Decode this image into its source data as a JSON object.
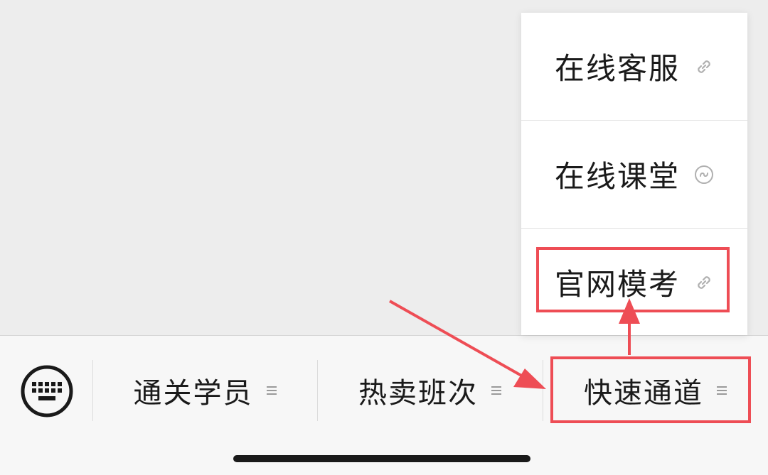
{
  "chat": {},
  "menu_bar": {
    "items": [
      {
        "label": "通关学员",
        "icon": "menu-lines-icon"
      },
      {
        "label": "热卖班次",
        "icon": "menu-lines-icon"
      },
      {
        "label": "快速通道",
        "icon": "menu-lines-icon"
      }
    ],
    "keyboard_icon": "keyboard-icon"
  },
  "submenu": {
    "items": [
      {
        "label": "在线客服",
        "icon": "link-icon"
      },
      {
        "label": "在线课堂",
        "icon": "mini-program-icon"
      },
      {
        "label": "官网模考",
        "icon": "link-icon"
      }
    ]
  },
  "annotation": {
    "color": "#ee4d55"
  }
}
